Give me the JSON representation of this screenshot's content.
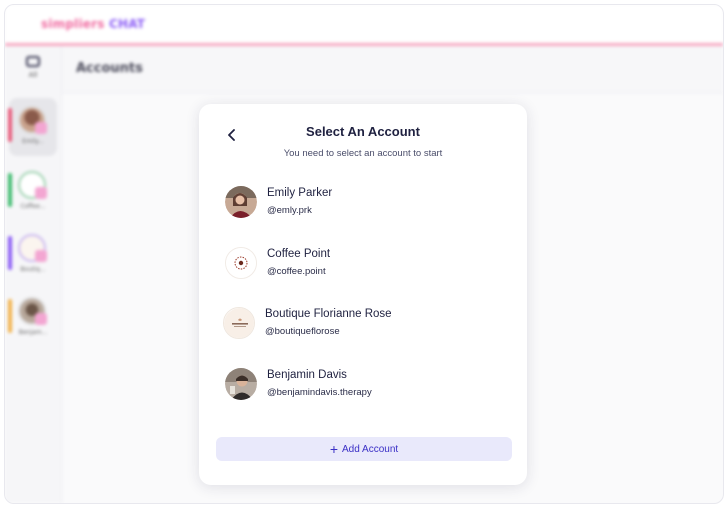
{
  "brand": {
    "part1": "simpliers ",
    "part2": "CHAT"
  },
  "sidebar": {
    "all_label": "All",
    "accounts": [
      {
        "label": "Emily...",
        "color": "#e85a7a"
      },
      {
        "label": "Coffee...",
        "color": "#3dbb6e"
      },
      {
        "label": "Boutiq...",
        "color": "#8b5cf6"
      },
      {
        "label": "Benjam...",
        "color": "#f2b24a"
      }
    ]
  },
  "main": {
    "title": "Accounts"
  },
  "modal": {
    "title": "Select An Account",
    "subtitle": "You need to select an account to start",
    "accounts": [
      {
        "name": "Emily Parker",
        "handle": "@emly.prk"
      },
      {
        "name": "Coffee Point",
        "handle": "@coffee.point"
      },
      {
        "name": "Boutique Florianne Rose",
        "handle": "@boutiqueflorose"
      },
      {
        "name": "Benjamin Davis",
        "handle": "@benjamindavis.therapy"
      }
    ],
    "add_button": {
      "icon": "+",
      "label": "Add Account"
    }
  },
  "colors": {
    "accent": "#3a2fc6",
    "brand_pink": "#f06aa0"
  }
}
